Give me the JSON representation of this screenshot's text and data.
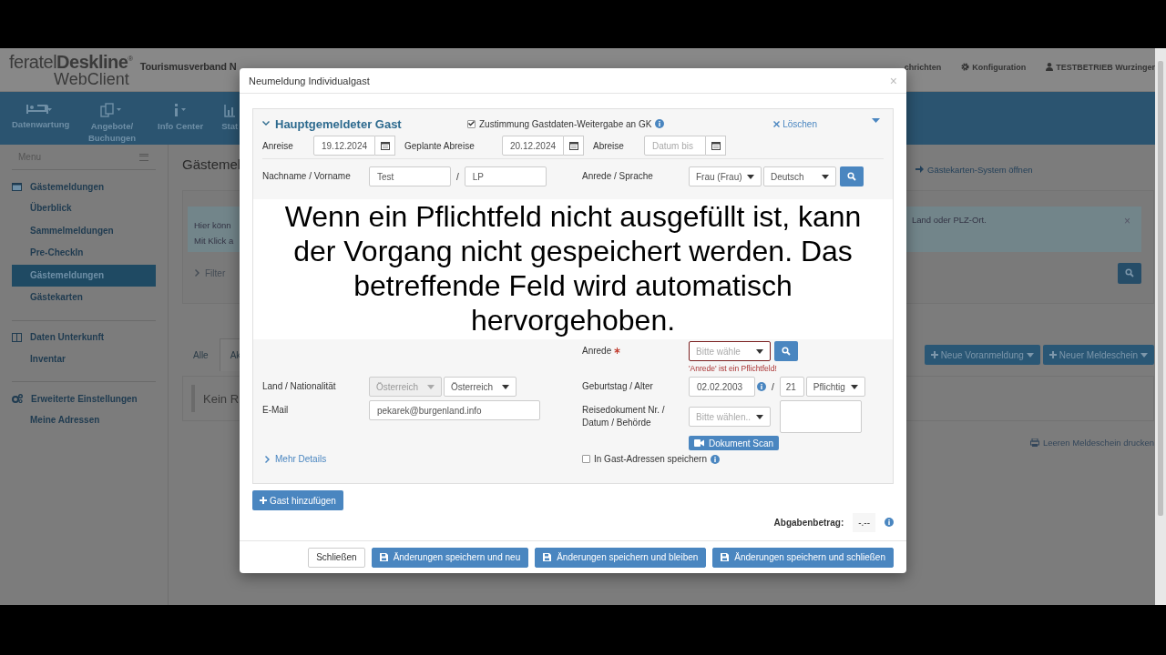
{
  "header": {
    "logo": "feratel**Deskline**$^{®}$",
    "logo_sub": "WebClient",
    "org": "Tourismusverband N",
    "links": [
      {
        "label": "chrichten"
      },
      {
        "label": "Konfiguration"
      },
      {
        "label": "TESTBETRIEB Wurzinger"
      }
    ]
  },
  "nav": [
    {
      "label": "Datenwartung"
    },
    {
      "label": "Angebote/ Buchungen"
    },
    {
      "label": "Info Center"
    },
    {
      "label": "Stat"
    }
  ],
  "sidebar": {
    "title": "Menu",
    "groups": [
      {
        "label": "Gästemeldungen",
        "items": [
          {
            "label": "Überblick",
            "selected": false
          },
          {
            "label": "Sammelmeldungen",
            "selected": false
          },
          {
            "label": "Pre-CheckIn",
            "selected": false
          },
          {
            "label": "Gästemeldungen",
            "selected": true
          },
          {
            "label": "Gästekarten",
            "selected": false
          }
        ]
      },
      {
        "label": "Daten Unterkunft",
        "items": [
          {
            "label": "Inventar",
            "selected": false
          }
        ]
      },
      {
        "label": "Erweiterte Einstellungen",
        "items": [
          {
            "label": "Meine Adressen",
            "selected": false
          }
        ]
      }
    ]
  },
  "main": {
    "title": "Gästemel",
    "card_link": "Gästekarten-System öffnen",
    "info_left": [
      "Hier könn",
      "Mit Klick a"
    ],
    "info_right": "Land oder PLZ-Ort.",
    "info_close": "×",
    "filter": "Filter",
    "tabs": [
      {
        "label": "Alle",
        "selected": false
      },
      {
        "label": "Ak",
        "selected": true
      }
    ],
    "buttons": [
      "Neue Voranmeldung",
      "Neuer Meldeschein"
    ],
    "result": "Kein R",
    "print": "Leeren Meldeschein drucken"
  },
  "modal": {
    "title": "Neumeldung Individualgast",
    "close": "×",
    "panel": {
      "heading": "Hauptgemeldeter Gast",
      "consent": {
        "label": "Zustimmung Gastdaten-Weitergabe an GK",
        "checked": true
      },
      "delete": "Löschen",
      "dates": [
        {
          "label": "Anreise",
          "value": "19.12.2024"
        },
        {
          "label": "Geplante Abreise",
          "value": "20.12.2024"
        },
        {
          "label": "Abreise",
          "placeholder": "Datum bis"
        }
      ],
      "rows_top": [
        {
          "left": {
            "label": "Nachname / Vorname",
            "controls": [
              {
                "kind": "text",
                "value": "Test"
              },
              {
                "kind": "sep",
                "text": "/"
              },
              {
                "kind": "text",
                "value": "LP"
              }
            ]
          },
          "right": {
            "label": "Anrede / Sprache",
            "controls": [
              {
                "kind": "select",
                "value": "Frau (Frau)"
              },
              {
                "kind": "select",
                "value": "Deutsch"
              },
              {
                "kind": "search"
              }
            ]
          }
        }
      ],
      "rows_bottom": [
        {
          "right": {
            "label": "Anrede",
            "required": true,
            "controls": [
              {
                "kind": "select",
                "placeholder": "Bitte wähle",
                "error": true
              },
              {
                "kind": "search"
              }
            ],
            "error_text": "'Anrede' ist ein Pflichtfeld!"
          }
        },
        {
          "left": {
            "label": "Land / Nationalität",
            "controls": [
              {
                "kind": "select",
                "value": "Österreich",
                "disabled": true
              },
              {
                "kind": "select",
                "value": "Österreich",
                "disabled": false
              }
            ]
          },
          "right": {
            "label": "Geburtstag / Alter",
            "controls": [
              {
                "kind": "text-mid",
                "value": "02.02.2003"
              },
              {
                "kind": "info"
              },
              {
                "kind": "sep",
                "text": "/"
              },
              {
                "kind": "number",
                "value": "21"
              },
              {
                "kind": "select-short",
                "value": "Pflichtig"
              }
            ]
          }
        },
        {
          "left": {
            "label": "E-Mail",
            "controls": [
              {
                "kind": "text-wide",
                "value": "pekarek@burgenland.info"
              }
            ]
          },
          "right": {
            "label": "Reisedokument Nr. / Datum / Behörde",
            "controls": [
              {
                "kind": "select",
                "placeholder": "Bitte wählen.."
              },
              {
                "kind": "textarea"
              }
            ],
            "button": "Dokument Scan"
          }
        }
      ],
      "more_details": "Mehr Details",
      "save_address": {
        "label": "In Gast-Adressen speichern",
        "checked": false
      }
    },
    "caption": "Wenn ein Pflichtfeld nicht ausgefüllt ist, kann der Vorgang nicht gespeichert werden. Das betreffende Feld wird automatisch hervorgehoben.",
    "add_guest": "Gast hinzufügen",
    "fee": {
      "label": "Abgabenbetrag:",
      "value": "-.--"
    },
    "footer": [
      {
        "label": "Schließen",
        "kind": "default"
      },
      {
        "label": "Änderungen speichern und neu",
        "kind": "primary"
      },
      {
        "label": "Änderungen speichern und bleiben",
        "kind": "primary"
      },
      {
        "label": "Änderungen speichern und schließen",
        "kind": "primary"
      }
    ]
  }
}
